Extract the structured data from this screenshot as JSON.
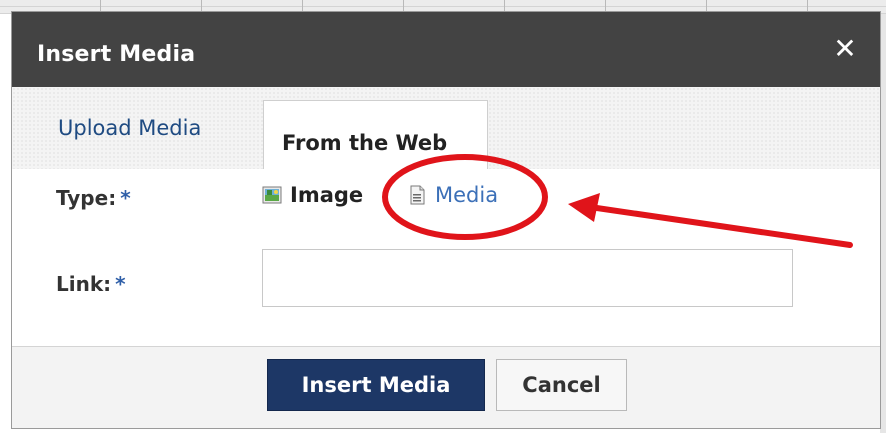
{
  "dialog": {
    "title": "Insert Media",
    "close_glyph": "✕"
  },
  "tabs": [
    {
      "label": "Upload Media",
      "active": false
    },
    {
      "label": "From the Web",
      "active": true
    }
  ],
  "form": {
    "type_label": "Type:",
    "link_label": "Link:",
    "required_mark": "*",
    "type_options": [
      {
        "label": "Image",
        "icon": "image-icon",
        "selected": true
      },
      {
        "label": "Media",
        "icon": "document-icon",
        "selected": false
      }
    ],
    "link_value": "",
    "link_placeholder": ""
  },
  "buttons": {
    "insert_label": "Insert Media",
    "cancel_label": "Cancel"
  },
  "colors": {
    "titlebar": "#434343",
    "primary_button": "#1d3766",
    "link": "#3c70b8",
    "annotation": "#e0141a"
  }
}
